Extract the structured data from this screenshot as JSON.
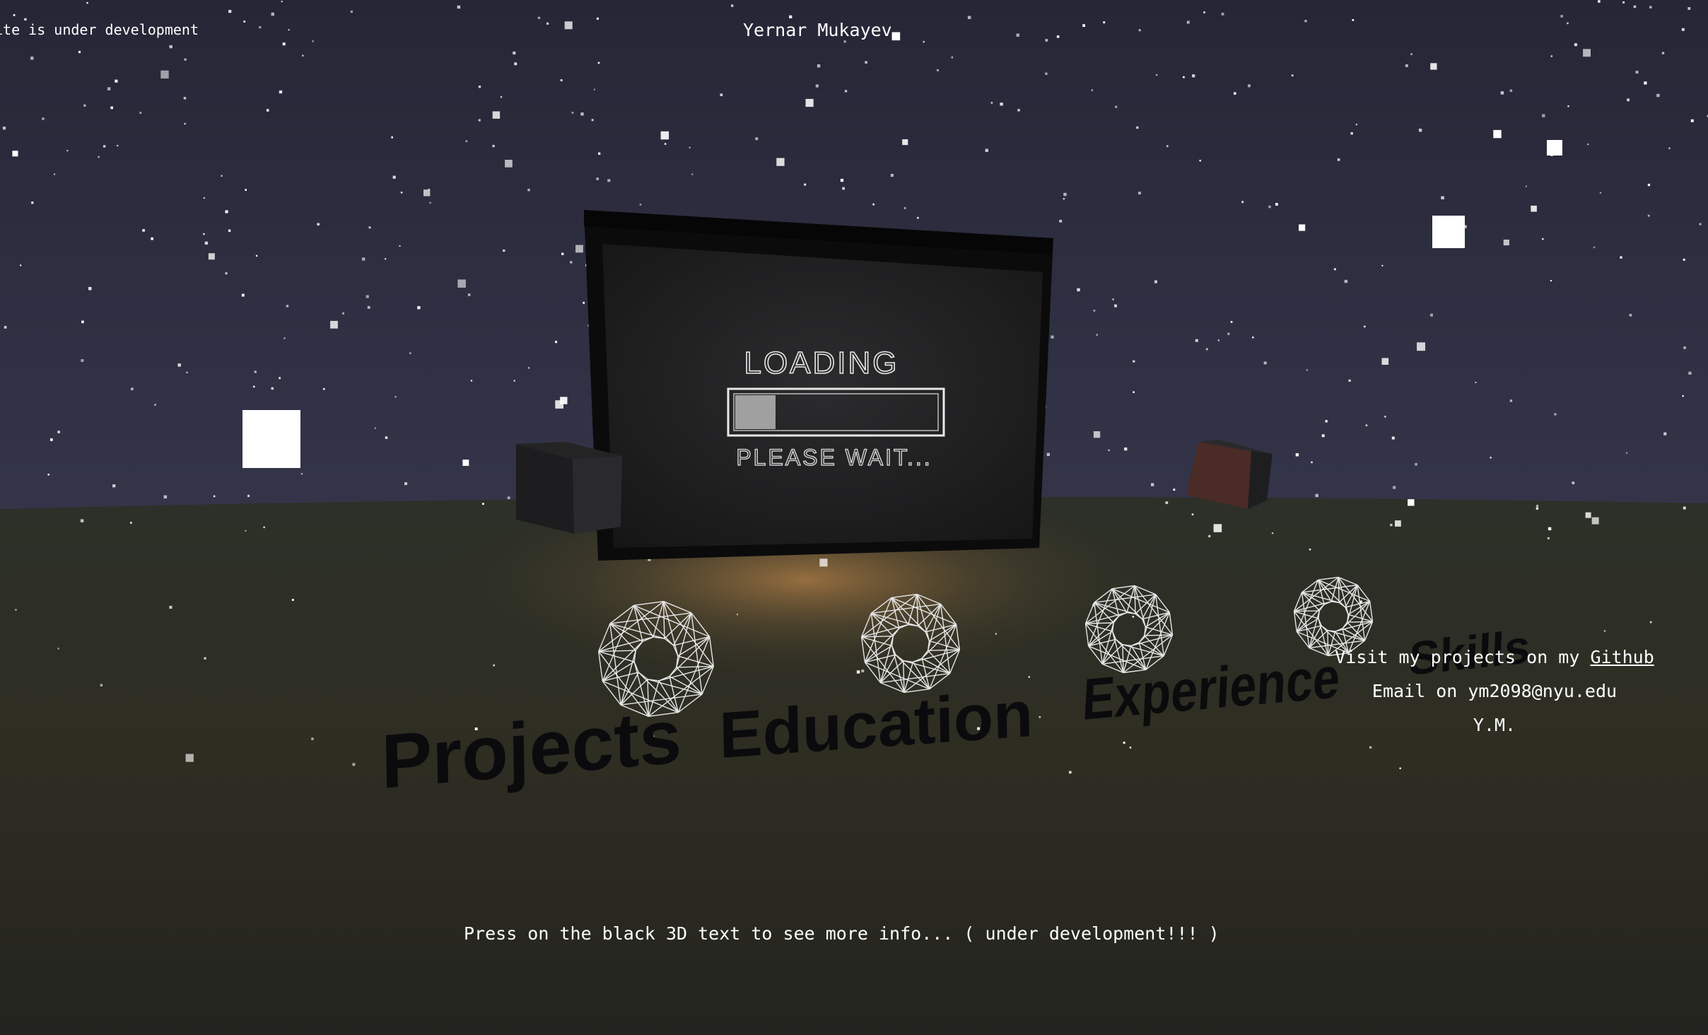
{
  "header": {
    "dev_note": "ite is under development",
    "site_name": "Yernar Mukayev"
  },
  "board": {
    "loading_label": "LOADING",
    "wait_label": "PLEASE WAIT...",
    "progress": 0.2
  },
  "nav": {
    "items": [
      "Projects",
      "Education",
      "Experience",
      "Skills"
    ]
  },
  "contact": {
    "github_prefix": "Visit my projects on my ",
    "github_link": "Github",
    "email_line": "Email on ym2098@nyu.edu",
    "signature": "Y.M."
  },
  "footer": {
    "hint": "Press on the black 3D text to see more info... ( under development!!! )"
  },
  "colors": {
    "sky": "#2a2b3d",
    "ground": "#2b2b22",
    "glow": "#a97a44",
    "board": "#1b1b1d",
    "chalk": "#e8e8e8",
    "brown_cube": "#4a2b26"
  }
}
